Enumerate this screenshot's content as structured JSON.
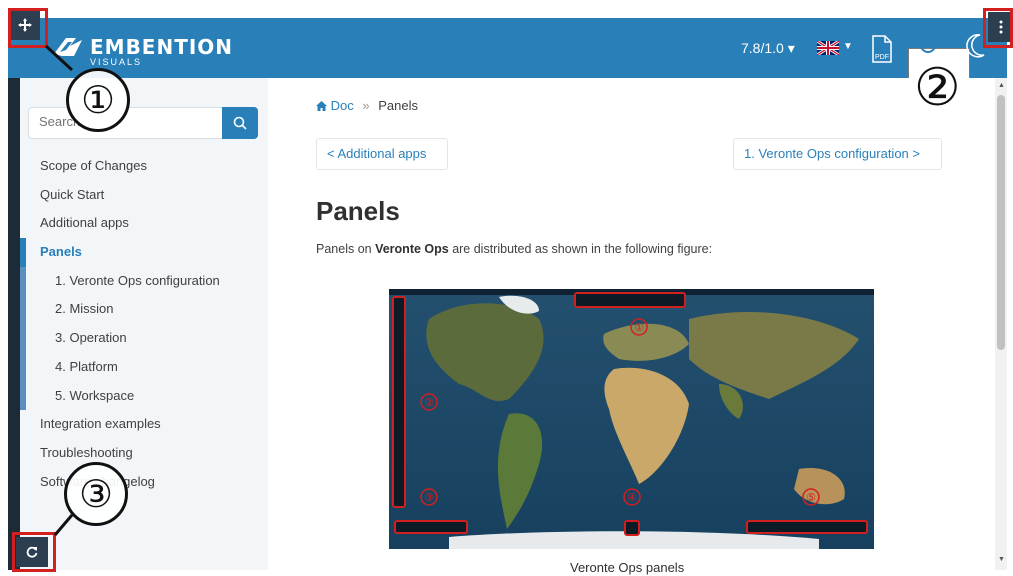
{
  "header": {
    "logo_text": "EMBENTION",
    "logo_sub": "VISUALS",
    "version": "7.8/1.0 ▾",
    "pdf_label": "PDF"
  },
  "search": {
    "placeholder": "Search"
  },
  "nav": {
    "items": [
      {
        "label": "Scope of Changes"
      },
      {
        "label": "Quick Start"
      },
      {
        "label": "Additional apps"
      },
      {
        "label": "Panels"
      },
      {
        "label": "1. Veronte Ops configuration"
      },
      {
        "label": "2. Mission"
      },
      {
        "label": "3. Operation"
      },
      {
        "label": "4. Platform"
      },
      {
        "label": "5. Workspace"
      },
      {
        "label": "Integration examples"
      },
      {
        "label": "Troubleshooting"
      },
      {
        "label": "Software changelog"
      }
    ]
  },
  "breadcrumb": {
    "home": "Doc",
    "sep": "»",
    "current": "Panels"
  },
  "pager": {
    "prev": "< Additional apps",
    "next": "1. Veronte Ops configuration >"
  },
  "page": {
    "title": "Panels",
    "intro_pre": "Panels on ",
    "intro_bold": "Veronte Ops",
    "intro_post": " are distributed as shown in the following figure:",
    "caption": "Veronte Ops panels"
  },
  "callouts": {
    "one": "①",
    "two": "②",
    "three": "③"
  },
  "figure_callouts": [
    "①",
    "②",
    "③",
    "④",
    "⑤"
  ],
  "colors": {
    "header": "#2980b9",
    "accent": "#2980b9",
    "callout_red": "#d21f1f",
    "sidebar_bg": "#f3f6f9"
  }
}
